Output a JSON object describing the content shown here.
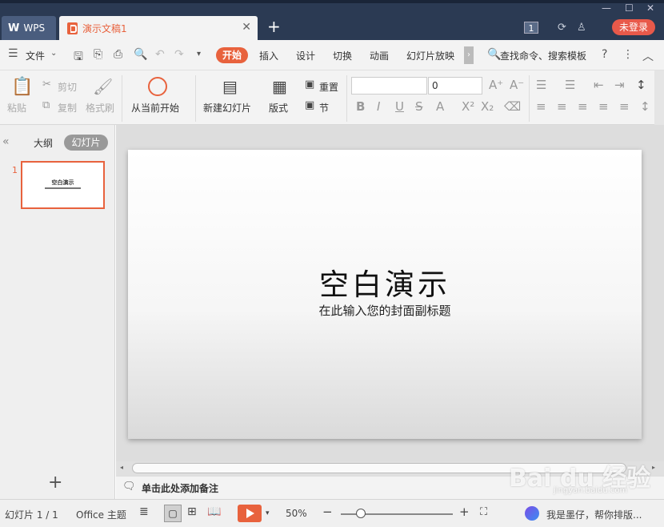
{
  "titlebar": {
    "wps_tab": "WPS",
    "doc_tab": "演示文稿1",
    "window_count": "1",
    "login_button": "未登录"
  },
  "menu": {
    "file": "文件",
    "tabs": [
      "开始",
      "插入",
      "设计",
      "切换",
      "动画",
      "幻灯片放映"
    ],
    "search": "查找命令、搜索模板"
  },
  "ribbon": {
    "paste": "粘贴",
    "cut": "剪切",
    "copy": "复制",
    "format_painter": "格式刷",
    "from_current": "从当前开始",
    "new_slide": "新建幻灯片",
    "layout": "版式",
    "reset": "重置",
    "section": "节",
    "font_size_value": "0"
  },
  "left_pane": {
    "outline_tab": "大纲",
    "slides_tab": "幻灯片",
    "slide_number": "1",
    "thumb_title": "空白演示"
  },
  "slide": {
    "title": "空白演示",
    "subtitle": "在此输入您的封面副标题"
  },
  "notes": {
    "placeholder": "单击此处添加备注"
  },
  "statusbar": {
    "slide_counter": "幻灯片 1 / 1",
    "theme": "Office 主题",
    "zoom": "50%",
    "zoom_level": 0.18,
    "assistant": "我是墨仔，帮你排版..."
  },
  "watermark": {
    "brand": "Bai du 经验",
    "url": "jingyan.baidu.com"
  }
}
